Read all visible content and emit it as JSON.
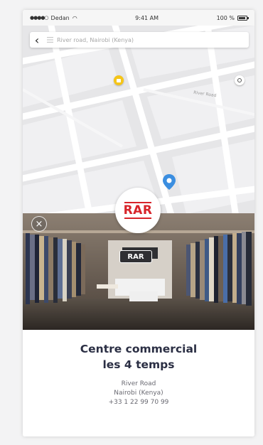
{
  "status_bar": {
    "carrier": "Dedan",
    "time": "9:41 AM",
    "battery": "100 %"
  },
  "search": {
    "back_icon": "chevron-left-icon",
    "menu_icon": "menu-icon",
    "placeholder": "River road, Nairobi (Kenya)"
  },
  "map": {
    "street_label": "River Road",
    "markers": [
      {
        "type": "store-marker",
        "color": "#f5c518"
      },
      {
        "type": "location-pin",
        "color": "#3b8ee0"
      }
    ],
    "locate_icon": "crosshair-icon"
  },
  "store": {
    "logo_text": "RAR",
    "logo_color": "#d7242a",
    "sign_text": "RAR",
    "name_line1": "Centre commercial",
    "name_line2": "les 4 temps",
    "address_line1": "River Road",
    "address_line2": "Nairobi (Kenya)",
    "phone": "+33 1 22 99 70 99"
  },
  "close_icon": "close-icon"
}
